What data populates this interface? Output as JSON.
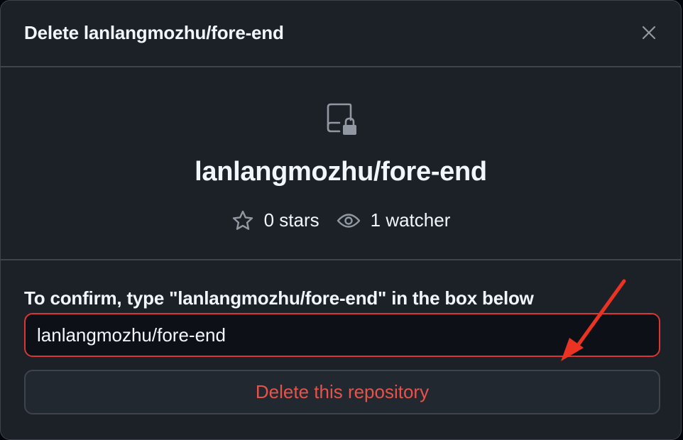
{
  "dialog": {
    "title": "Delete lanlangmozhu/fore-end",
    "close_icon": "close-icon"
  },
  "repo": {
    "icon": "repo-locked-icon",
    "name": "lanlangmozhu/fore-end",
    "stars_label": "0 stars",
    "watchers_label": "1 watcher"
  },
  "confirm": {
    "label": "To confirm, type \"lanlangmozhu/fore-end\" in the box below",
    "input_value": "lanlangmozhu/fore-end"
  },
  "actions": {
    "delete_label": "Delete this repository"
  },
  "colors": {
    "danger": "#e5534b",
    "annotation_arrow": "#ea3323"
  }
}
